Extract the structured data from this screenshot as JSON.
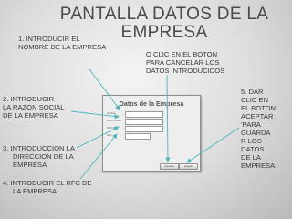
{
  "title": "PANTALLA DATOS DE LA EMPRESA",
  "notes": {
    "step1_line1": "1. INTRODUCIR EL",
    "step1_line2": "NOMBRE DE LA EMPRESA",
    "cancel_line1": "O  CLIC EN EL BOTON",
    "cancel_line2": "PARA  CANCELAR LOS",
    "cancel_line3": "DATOS INTRODUCIDOS",
    "step2_line1": "2.  INTRODUCIR",
    "step2_line2": "LA RAZON SOCIAL",
    "step2_line3": "DE LA EMPRESA",
    "step3_line1": "3. INTRODUCCION LA",
    "step3_line2": "DIRECCION DE LA",
    "step3_line3": "EMPRESA",
    "step4_line1": "4.  INTRODUCIR EL RFC DE",
    "step4_line2": "LA EMPRESA",
    "step5_lines": [
      "5. DAR",
      "CLIC EN",
      "EL BOTON",
      "ACEPTAR",
      "’PARA",
      "GUARDA",
      "R LOS",
      "DATOS",
      "DE LA",
      "EMPRESA"
    ]
  },
  "dialog": {
    "title": "Datos de la Empresa",
    "fields": [
      {
        "label": "Nombre:"
      },
      {
        "label": "Razón Social:"
      },
      {
        "label": "Dirección:"
      },
      {
        "label": "RFC:"
      }
    ],
    "cancel_label": "Cancelar",
    "ok_label": "Aceptar"
  },
  "colors": {
    "arrow": "#4db4bd"
  }
}
